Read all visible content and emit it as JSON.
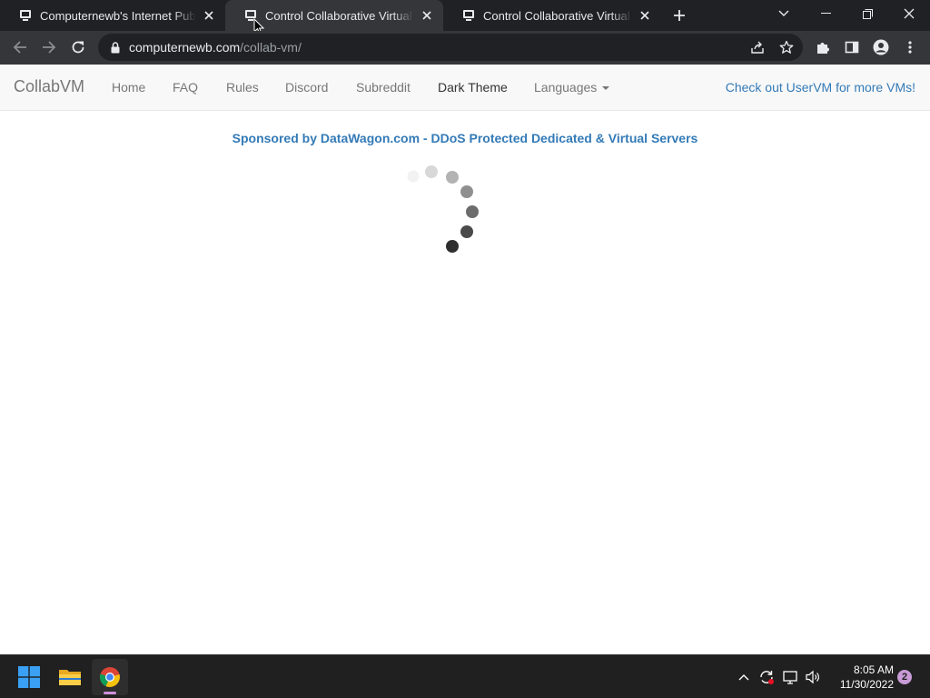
{
  "browser": {
    "tabs": [
      {
        "title": "Computernewb's Internet Pub Hub",
        "active": false
      },
      {
        "title": "Control Collaborative Virtual Machines!",
        "active": true
      },
      {
        "title": "Control Collaborative Virtual Machines!",
        "active": false
      }
    ],
    "url": {
      "host": "computernewb.com",
      "path": "/collab-vm/"
    }
  },
  "navbar": {
    "brand": "CollabVM",
    "links": [
      "Home",
      "FAQ",
      "Rules",
      "Discord",
      "Subreddit",
      "Dark Theme",
      "Languages"
    ],
    "right_link": "Check out UserVM for more VMs!"
  },
  "content": {
    "sponsor_text": "Sponsored by DataWagon.com - DDoS Protected Dedicated & Virtual Servers"
  },
  "taskbar": {
    "time": "8:05 AM",
    "date": "11/30/2022",
    "notification_count": "2"
  },
  "colors": {
    "link_blue": "#337ab7",
    "nav_text": "#777777",
    "chrome_dark": "#202124",
    "chrome_toolbar": "#35363a"
  }
}
